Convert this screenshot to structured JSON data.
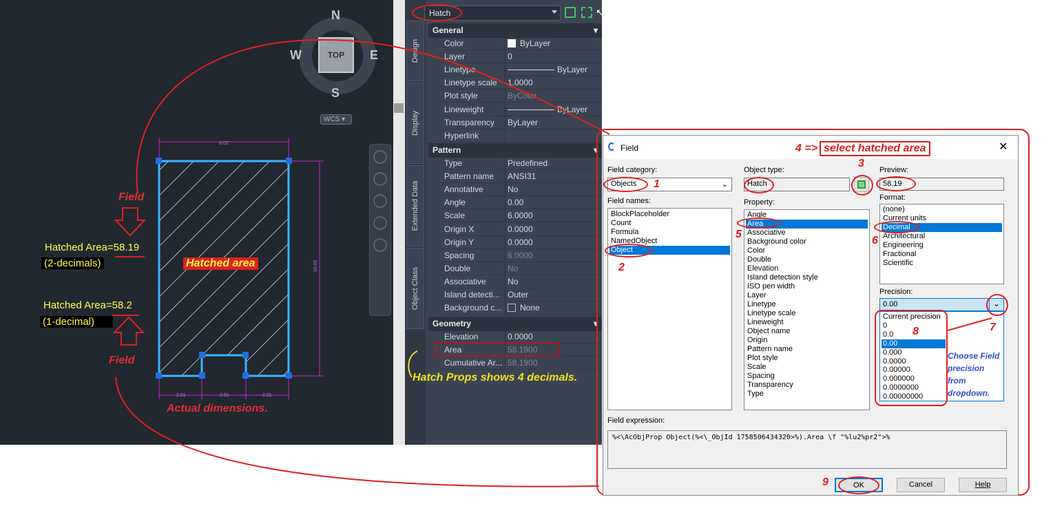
{
  "viewport": {
    "compass": {
      "n": "N",
      "s": "S",
      "e": "E",
      "w": "W",
      "cube": "TOP"
    },
    "wcs_label": "WCS",
    "field_top_label": "Field",
    "field_bottom_label": "Field",
    "hatched_area_2dec": "Hatched Area=58.19",
    "two_decimals_note": "(2-decimals)",
    "hatched_area_1dec": "Hatched Area=58.2",
    "one_decimal_note": "(1-decimal)",
    "hatched_area_label": "Hatched area",
    "actual_dimensions_note": "Actual dimensions.",
    "dim_top": "6.02",
    "dim_side": "10.00",
    "dim_bottom": [
      "2.01",
      "2.01",
      "2.01"
    ]
  },
  "properties": {
    "selection": "Hatch",
    "tabs": [
      "Design",
      "Display",
      "Extended Data",
      "Object Class"
    ],
    "sections": {
      "general": "General",
      "pattern": "Pattern",
      "geometry": "Geometry"
    },
    "general_rows": [
      {
        "key": "Color",
        "value": "ByLayer"
      },
      {
        "key": "Layer",
        "value": "0"
      },
      {
        "key": "Linetype",
        "value": "ByLayer"
      },
      {
        "key": "Linetype scale",
        "value": "1.0000"
      },
      {
        "key": "Plot style",
        "value": "ByColor"
      },
      {
        "key": "Lineweight",
        "value": "ByLayer"
      },
      {
        "key": "Transparency",
        "value": "ByLayer"
      },
      {
        "key": "Hyperlink",
        "value": ""
      }
    ],
    "pattern_rows": [
      {
        "key": "Type",
        "value": "Predefined"
      },
      {
        "key": "Pattern name",
        "value": "ANSI31"
      },
      {
        "key": "Annotative",
        "value": "No"
      },
      {
        "key": "Angle",
        "value": "0.00"
      },
      {
        "key": "Scale",
        "value": "6.0000"
      },
      {
        "key": "Origin X",
        "value": "0.0000"
      },
      {
        "key": "Origin Y",
        "value": "0.0000"
      },
      {
        "key": "Spacing",
        "value": "6.0000"
      },
      {
        "key": "Double",
        "value": "No"
      },
      {
        "key": "Associative",
        "value": "No"
      },
      {
        "key": "Island detecti...",
        "value": "Outer"
      },
      {
        "key": "Background c...",
        "value": "None"
      }
    ],
    "geometry_rows": [
      {
        "key": "Elevation",
        "value": "0.0000"
      },
      {
        "key": "Area",
        "value": "58.1900"
      },
      {
        "key": "Cumulative Ar...",
        "value": "58.1900"
      }
    ],
    "note": "Hatch Props shows 4 decimals."
  },
  "dialog": {
    "title": "Field",
    "step4_note": "4 => select hatched area",
    "field_category_label": "Field category:",
    "field_category_value": "Objects",
    "field_names_label": "Field names:",
    "field_names": [
      "BlockPlaceholder",
      "Count",
      "Formula",
      "NamedObject",
      "Object"
    ],
    "field_names_selected": 4,
    "object_type_label": "Object type:",
    "object_type_value": "Hatch",
    "property_label": "Property:",
    "properties": [
      "Angle",
      "Area",
      "Associative",
      "Background color",
      "Color",
      "Double",
      "Elevation",
      "Island detection style",
      "ISO pen width",
      "Layer",
      "Linetype",
      "Linetype scale",
      "Lineweight",
      "Object name",
      "Origin",
      "Pattern name",
      "Plot style",
      "Scale",
      "Spacing",
      "Transparency",
      "Type"
    ],
    "property_selected": 1,
    "preview_label": "Preview:",
    "preview_value": "58.19",
    "format_label": "Format:",
    "formats": [
      "(none)",
      "Current units",
      "Decimal",
      "Architectural",
      "Engineering",
      "Fractional",
      "Scientific"
    ],
    "format_selected": 2,
    "precision_label": "Precision:",
    "precision_value": "0.00",
    "precision_options": [
      "Current precision",
      "0",
      "0.0",
      "0.00",
      "0.000",
      "0.0000",
      "0.00000",
      "0.000000",
      "0.0000000",
      "0.00000000"
    ],
    "precision_selected": 3,
    "precision_note": "Choose Field precision from dropdown.",
    "expression_label": "Field expression:",
    "expression": "%<\\AcObjProp Object(%<\\_ObjId 1758506434320>%).Area \\f \"%lu2%pr2\">%",
    "ok": "OK",
    "cancel": "Cancel",
    "help": "Help",
    "step_numbers": [
      "1",
      "2",
      "3",
      "5",
      "6",
      "7",
      "8",
      "9"
    ]
  },
  "colors": {
    "accent_red": "#e02020",
    "selection_blue": "#0078d7",
    "hatch_cyan": "#3db4ff",
    "field_yellow": "#ffff40"
  }
}
